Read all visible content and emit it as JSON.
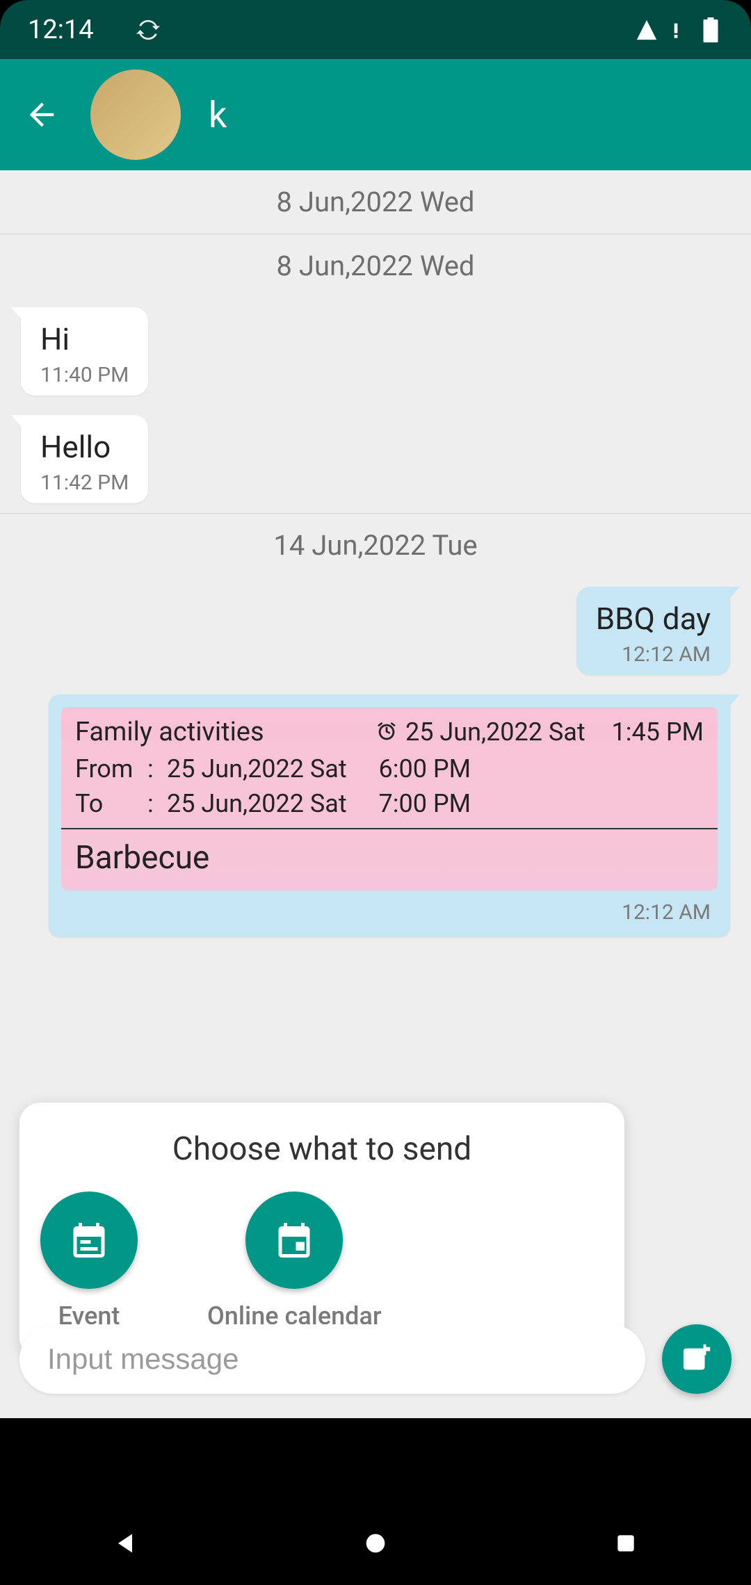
{
  "status": {
    "time": "12:14",
    "signal": "signal",
    "battery": "battery"
  },
  "header": {
    "name": "k"
  },
  "dividers": {
    "d1": "8 Jun,2022 Wed",
    "d2": "8 Jun,2022 Wed",
    "d3": "14 Jun,2022 Tue"
  },
  "msgs": {
    "m1": {
      "text": "Hi",
      "time": "11:40 PM"
    },
    "m2": {
      "text": "Hello",
      "time": "11:42 PM"
    },
    "m3": {
      "text": "BBQ day",
      "time": "12:12 AM"
    }
  },
  "event": {
    "category": "Family activities",
    "alarm_date": "25 Jun,2022 Sat",
    "alarm_time": "1:45 PM",
    "from_label": "From",
    "to_label": "To",
    "colon": ":",
    "from_date": "25 Jun,2022 Sat",
    "from_time": "6:00 PM",
    "to_date": "25 Jun,2022 Sat",
    "to_time": "7:00 PM",
    "name": "Barbecue",
    "sent_time": "12:12 AM"
  },
  "popup": {
    "title": "Choose what to send",
    "event_label": "Event",
    "calendar_label": "Online calendar"
  },
  "input": {
    "placeholder": "Input message",
    "value": ""
  },
  "colors": {
    "accent": "#009688",
    "bubble_sent": "#c6e6f3",
    "event_card": "#f9c2d6"
  }
}
